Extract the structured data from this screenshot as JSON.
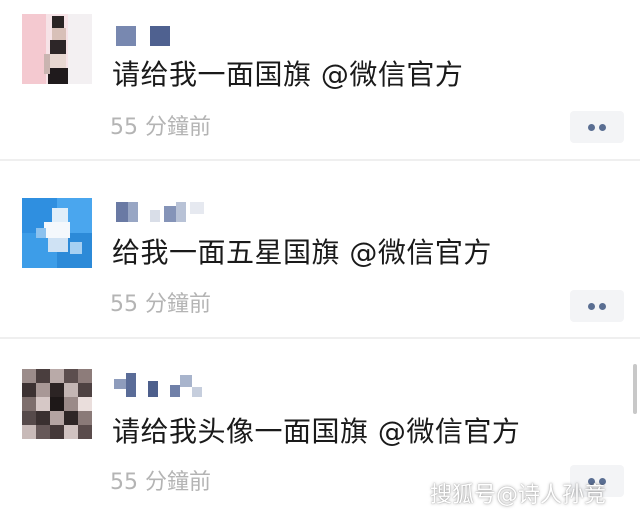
{
  "posts": [
    {
      "comment": "请给我一面国旗 @微信官方",
      "time": "55 分鐘前"
    },
    {
      "comment": "给我一面五星国旗 @微信官方",
      "time": "55 分鐘前"
    },
    {
      "comment": "请给我头像一面国旗 @微信官方",
      "time": "55 分鐘前"
    }
  ],
  "more_button_icon": "more-dots-icon",
  "watermark": "搜狐号@诗人孙竞",
  "colors": {
    "text": "#1a1a1a",
    "timestamp": "#b4b4b4",
    "dots": "#5a6e92",
    "button_bg": "#f3f4f6"
  }
}
